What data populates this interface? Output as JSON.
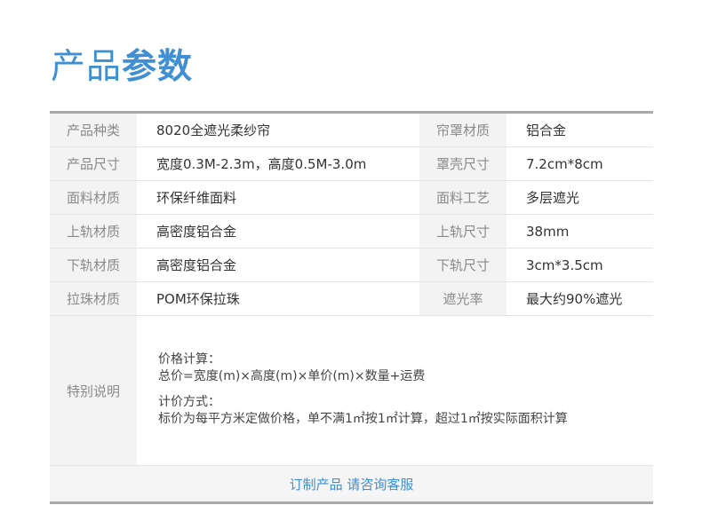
{
  "title": {
    "part1": "产品",
    "part2": "参数"
  },
  "rows": [
    {
      "l1": "产品种类",
      "v1": "8020全遮光柔纱帘",
      "l2": "帘罩材质",
      "v2": "铝合金"
    },
    {
      "l1": "产品尺寸",
      "v1": "宽度0.3M-2.3m，高度0.5M-3.0m",
      "l2": "罩壳尺寸",
      "v2": " 7.2cm*8cm"
    },
    {
      "l1": "面料材质",
      "v1": "环保纤维面料",
      "l2": "面料工艺",
      "v2": "多层遮光"
    },
    {
      "l1": "上轨材质",
      "v1": "高密度铝合金",
      "l2": "上轨尺寸",
      "v2": "38mm"
    },
    {
      "l1": "下轨材质",
      "v1": "高密度铝合金",
      "l2": "下轨尺寸",
      "v2": "3cm*3.5cm"
    },
    {
      "l1": "拉珠材质",
      "v1": "POM环保拉珠",
      "l2": "遮光率",
      "v2": "最大约90%遮光"
    }
  ],
  "note": {
    "label": "特别说明",
    "line1": "价格计算：",
    "line2": "总价=宽度(m)×高度(m)×单价(m)×数量+运费",
    "line3": "计价方式：",
    "line4": "标价为每平方米定做价格，单不满1㎡按1㎡计算，超过1㎡按实际面积计算"
  },
  "footer": {
    "link": "订制产品 请咨询客服"
  }
}
